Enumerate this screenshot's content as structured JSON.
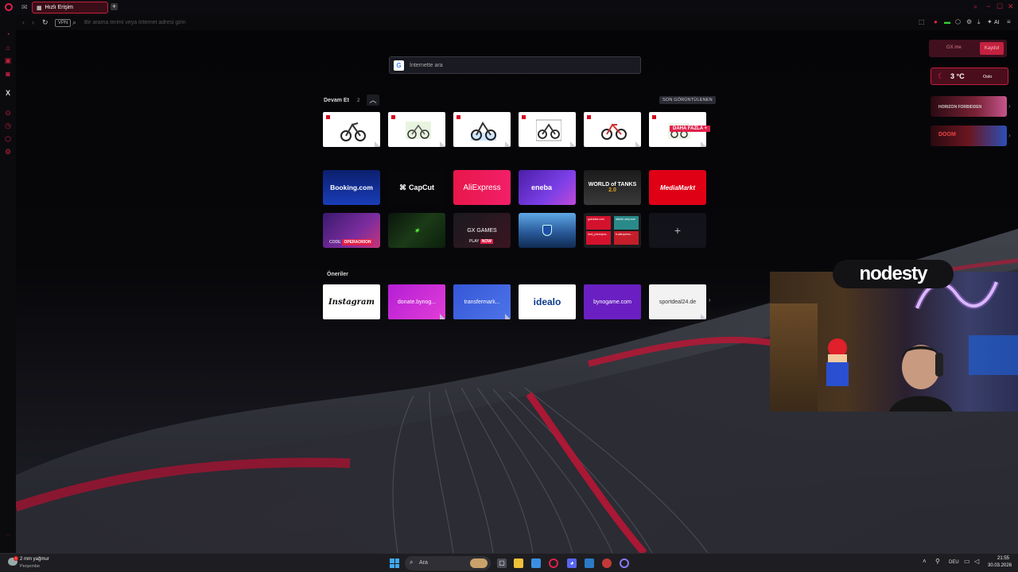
{
  "colors": {
    "accent": "#c3213f",
    "accent_bright": "#e0204a",
    "background": "#0a0a0d"
  },
  "tab": {
    "label": "Hızlı Erişim"
  },
  "address_bar": {
    "vpn": "VPN",
    "placeholder": "Bir arama terimi veya internet adresi girin",
    "ai": "AI"
  },
  "search": {
    "placeholder": "İnternette ara",
    "engine": "G"
  },
  "continue": {
    "title": "Devam Et",
    "count": "2",
    "recent_button": "SON GÖRÜNTÜLENEN",
    "more_badge": "DAHA FAZLA +"
  },
  "speed_dials": {
    "booking": "Booking.com",
    "capcut": "CapCut",
    "aliexpress": "AliExpress",
    "eneba": "eneba",
    "wot": "WORLD of TANKS",
    "wot_version": "2.0",
    "mediamarkt": "MediaMarkt",
    "opera_code": "CODE",
    "opera_code_value": "OPERAORION",
    "gx_games": "GX GAMES",
    "gx_play": "PLAY",
    "gx_now": "NOW",
    "add": "+"
  },
  "sites_tile": [
    "gokdolar.com",
    "alsmiri.orby.com",
    "hesl_pdveapra...",
    "tr.aliexpress..."
  ],
  "suggestions": {
    "title": "Öneriler",
    "items": [
      "Instagram",
      "donate.bynog...",
      "transfermark...",
      "idealo",
      "bynogame.com",
      "sportdeal24.de"
    ]
  },
  "widgets": {
    "gx_label": "GX.me",
    "gx_button": "Kaydol",
    "temperature": "3 °C",
    "city": "Oslo",
    "game1": "HORIZON FORBIDDEN",
    "game2": "DOOM"
  },
  "stream_name": "nodesty",
  "taskbar": {
    "weather": "2 mm yağmur",
    "day": "Perşembe",
    "search": "Ara",
    "lang": "DEU",
    "time": "21:55",
    "date": "30.03.2026",
    "badge": "1"
  }
}
